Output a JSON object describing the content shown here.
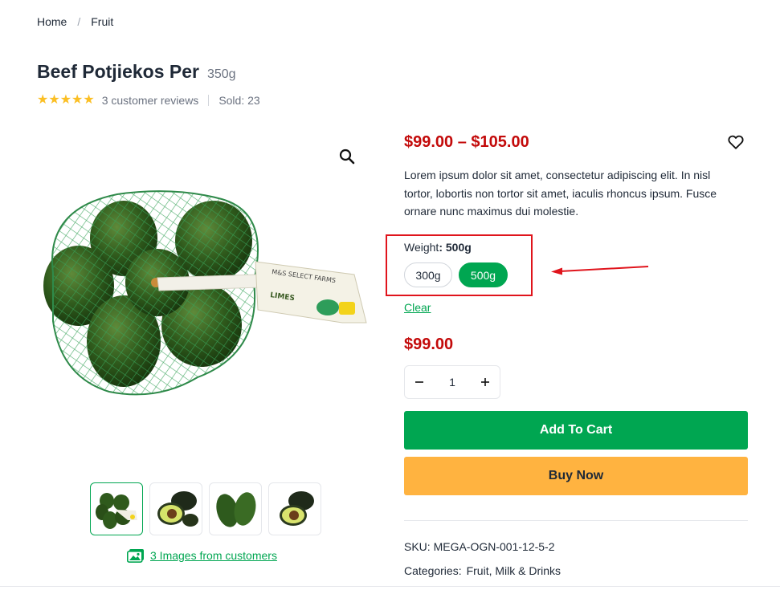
{
  "breadcrumb": {
    "home": "Home",
    "separator": "/",
    "current": "Fruit"
  },
  "product": {
    "title": "Beef Potjiekos Per",
    "title_weight": "350g",
    "rating_stars": 5,
    "reviews": "3 customer reviews",
    "sold": "Sold: 23",
    "price_range": "$99.00 – $105.00",
    "description": "Lorem ipsum dolor sit amet, consectetur adipiscing elit. In nisl tortor, lobortis non tortor sit amet, iaculis rhoncus ipsum. Fusce ornare nunc maximus dui molestie.",
    "weight_label": "Weight",
    "weight_selected": ": 500g",
    "options": [
      "300g",
      "500g"
    ],
    "clear": "Clear",
    "price": "$99.00",
    "quantity": "1",
    "add_to_cart": "Add To Cart",
    "buy_now": "Buy Now",
    "sku": "SKU: MEGA-OGN-001-12-5-2",
    "categories_label": "Categories:",
    "categories": "Fruit, Milk & Drinks",
    "customer_images": "3 Images from customers",
    "package_label_brand": "M&S SELECT FARMS",
    "package_label_product": "LIMES"
  },
  "colors": {
    "accent_green": "#00a651",
    "price_red": "#c30a0a",
    "buy_orange": "#ffb340",
    "highlight_red": "#e0141c",
    "star_yellow": "#fbbf24"
  },
  "icons": {
    "zoom": "magnifier-icon",
    "wishlist": "heart-icon",
    "qty_minus": "minus-icon",
    "qty_plus": "plus-icon",
    "customer_images": "image-gallery-icon"
  }
}
